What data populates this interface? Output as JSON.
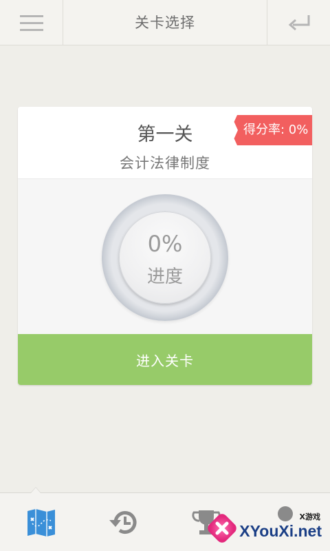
{
  "header": {
    "title": "关卡选择",
    "menu_icon": "hamburger-menu-icon",
    "back_icon": "return-arrow-icon"
  },
  "level_card": {
    "name": "第一关",
    "subtitle": "会计法律制度",
    "score_rate_label": "得分率: 0%",
    "progress_value": "0%",
    "progress_label": "进度",
    "enter_button_label": "进入关卡"
  },
  "tabbar": {
    "tabs": [
      {
        "icon": "map-icon",
        "active": true
      },
      {
        "icon": "history-clock-icon",
        "active": false
      },
      {
        "icon": "trophy-icon",
        "active": false
      },
      {
        "icon": "settings-icon",
        "active": false
      }
    ]
  },
  "watermark": {
    "small_text": "X游戏",
    "big_text": "XYouXi.net"
  },
  "colors": {
    "background": "#efeee9",
    "accent_green": "#97cb69",
    "ribbon_red": "#f25f5f",
    "icon_blue": "#3a8fd8",
    "icon_gray": "#8a8a8a"
  }
}
